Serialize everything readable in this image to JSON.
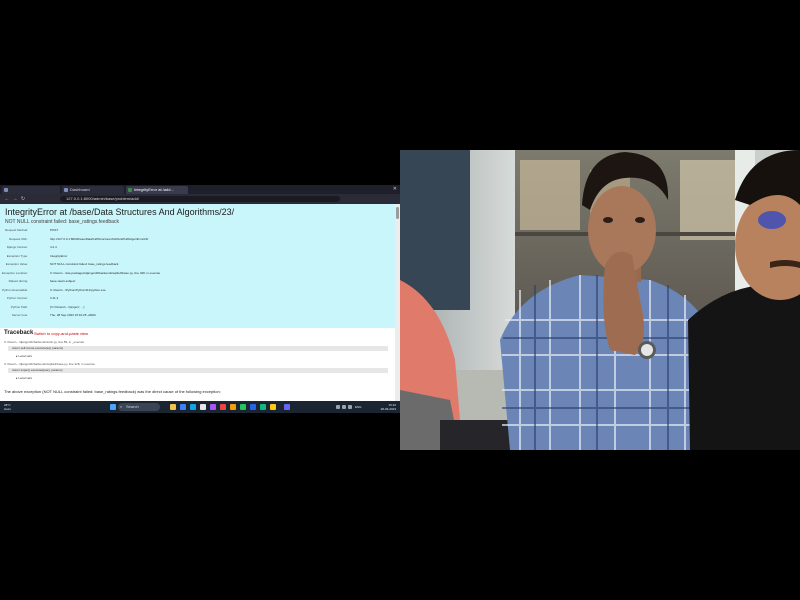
{
  "browser": {
    "tabs": [
      {
        "label": ""
      },
      {
        "label": "Dashboard"
      },
      {
        "label": "IntegrityError at /add..."
      },
      {
        "label": ""
      }
    ],
    "address": "127.0.0.1:8000/admin/base/problem/add/",
    "nav": {
      "back": "←",
      "forward": "→",
      "reload": "↻"
    }
  },
  "error_page": {
    "title": "IntegrityError at /base/Data Structures And Algorithms/23/",
    "subtitle": "NOT NULL constraint failed: base_ratings.feedback",
    "meta": [
      {
        "key": "Request Method:",
        "value": "POST"
      },
      {
        "key": "Request URL:",
        "value": "http://127.0.0.1:8000/base/Data%20Structures%20And%20Algorithms/23/"
      },
      {
        "key": "Django Version:",
        "value": "4.2.4"
      },
      {
        "key": "Exception Type:",
        "value": "IntegrityError"
      },
      {
        "key": "Exception Value:",
        "value": "NOT NULL constraint failed: base_ratings.feedback"
      },
      {
        "key": "Exception Location:",
        "value": "C:\\Users\\...\\site-packages\\django\\db\\backends\\sqlite3\\base.py, line 328, in execute"
      },
      {
        "key": "Raised during:",
        "value": "base.views.subject"
      },
      {
        "key": "Python Executable:",
        "value": "C:\\Users\\...\\Python\\Python311\\python.exe"
      },
      {
        "key": "Python Version:",
        "value": "3.11.4"
      },
      {
        "key": "Python Path:",
        "value": "['C:\\\\Users\\\\...\\\\project', ...]"
      },
      {
        "key": "Server time:",
        "value": "Thu, 28 Sep 2023 15:10:25 +0000"
      }
    ],
    "traceback": {
      "title": "Traceback",
      "switch_label": "Switch to copy-and-paste view",
      "frames": [
        {
          "location": "C:\\Users\\...\\django\\db\\backends\\utils.py, line 89, in _execute",
          "code": "return self.cursor.execute(sql, params)",
          "locals": "▸ Local vars"
        },
        {
          "location": "C:\\Users\\...\\django\\db\\backends\\sqlite3\\base.py, line 328, in execute",
          "code": "return super().execute(query, params)",
          "locals": "▸ Local vars"
        }
      ]
    },
    "footer_note": "The above exception (NOT NULL constraint failed: base_ratings.feedback) was the direct cause of the following exception:"
  },
  "taskbar": {
    "weather_temp": "28°C",
    "weather_desc": "Haze",
    "search_placeholder": "Search",
    "time": "15:10",
    "date": "28-09-2023",
    "lang": "ENG"
  },
  "colors": {
    "error_header_bg": "#c9f6fb",
    "taskbar_bg": "#1b2431",
    "browser_chrome": "#1f1f2b"
  },
  "webcam": {
    "description_icon": "webcam-feed"
  }
}
